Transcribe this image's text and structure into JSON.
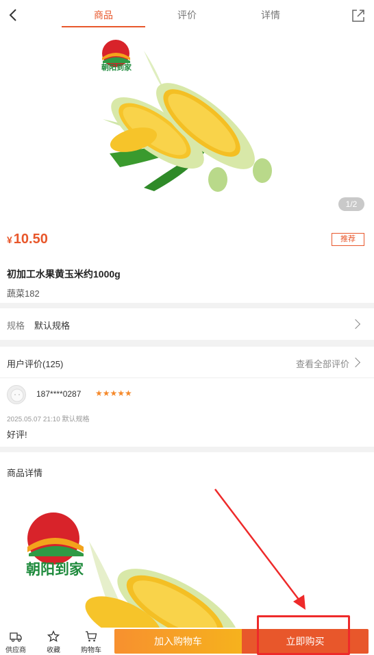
{
  "header": {
    "tabs": [
      {
        "label": "商品",
        "active": true
      },
      {
        "label": "评价",
        "active": false
      },
      {
        "label": "详情",
        "active": false
      }
    ],
    "back_icon": "chevron-left-icon",
    "share_icon": "share-icon"
  },
  "hero": {
    "brand_text": "朝阳到家",
    "pager": "1/2"
  },
  "product": {
    "currency": "¥",
    "price": "10.50",
    "badge": "推荐",
    "name": "初加工水果黄玉米约1000g",
    "category": "蔬菜182"
  },
  "spec": {
    "label": "规格",
    "value": "默认规格"
  },
  "reviews": {
    "title": "用户评价(125)",
    "view_all": "查看全部评价",
    "items": [
      {
        "user": "187****0287",
        "stars": "★★★★★",
        "meta": "2025.05.07 21:10 默认规格",
        "text": "好评!"
      }
    ]
  },
  "detail": {
    "title": "商品详情",
    "brand_text": "朝阳到家"
  },
  "bottom_bar": {
    "supplier": "供应商",
    "favorite": "收藏",
    "cart": "购物车",
    "add_to_cart": "加入购物车",
    "buy_now": "立即购买"
  },
  "colors": {
    "accent": "#e8572b",
    "star": "#f5892b",
    "cart_gradient_start": "#f7902f",
    "cart_gradient_end": "#f6b21d",
    "annotation": "#ee2a2a"
  }
}
